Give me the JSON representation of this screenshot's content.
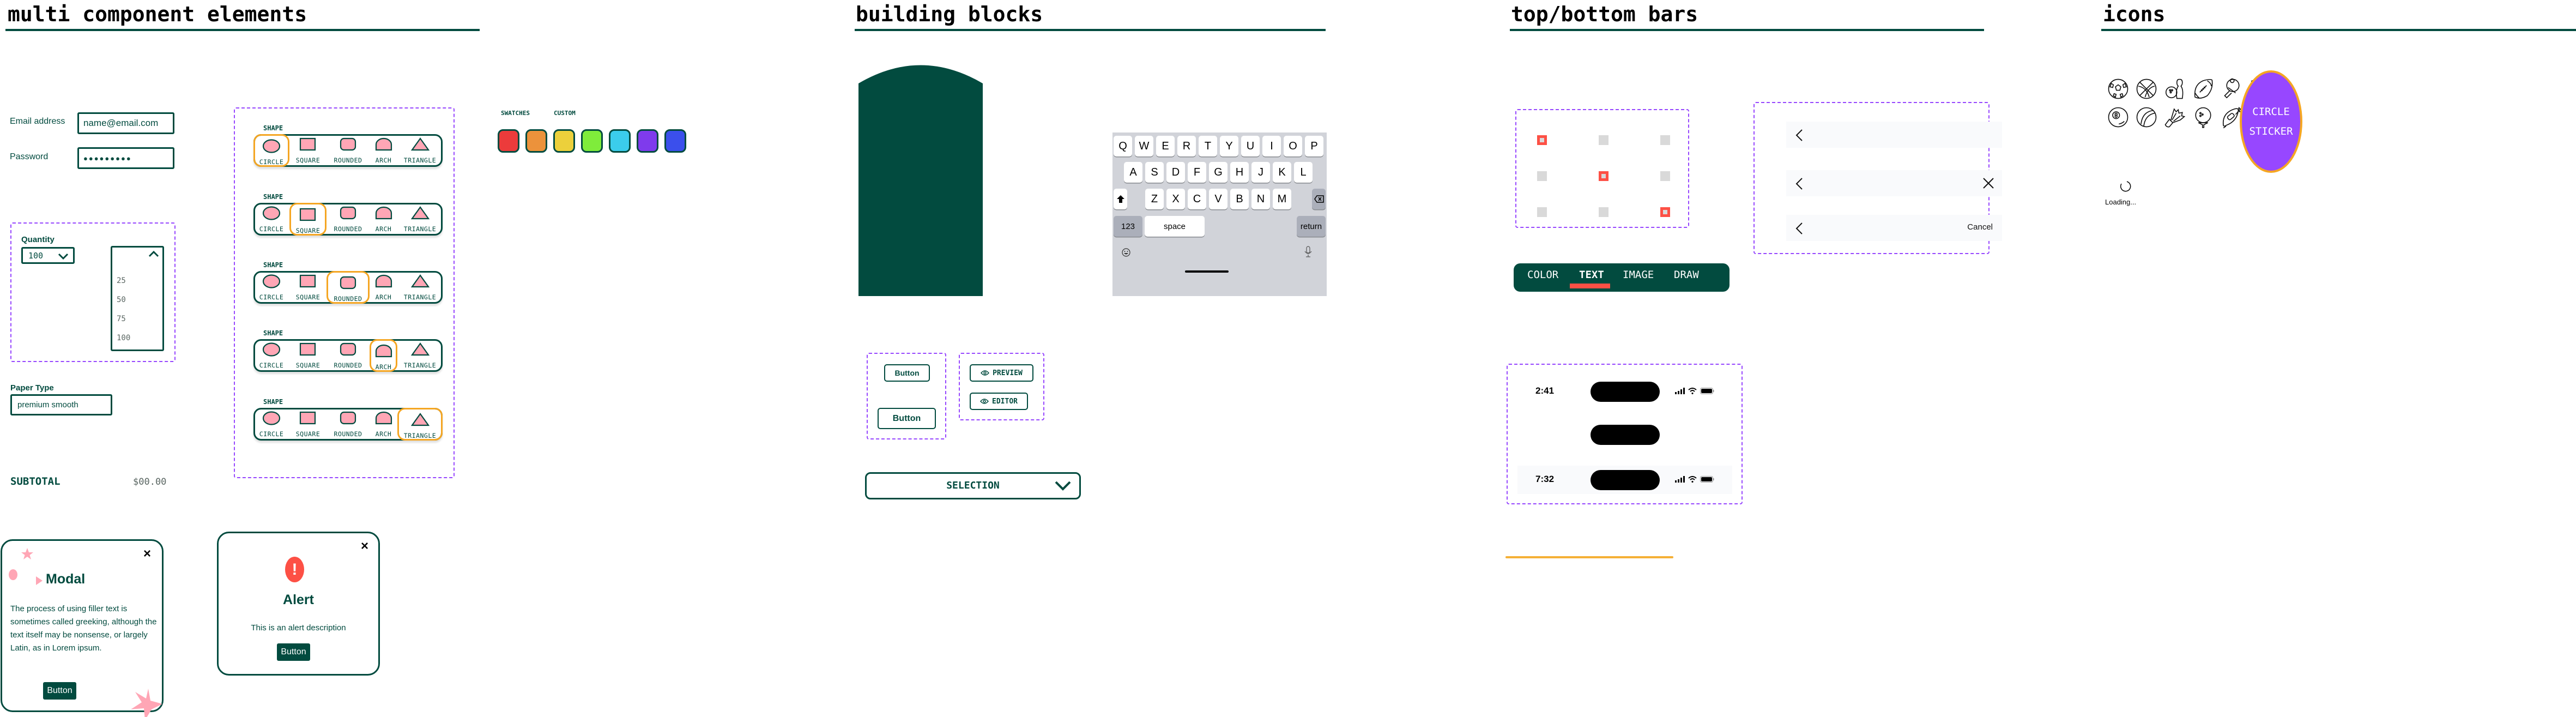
{
  "sections": {
    "multi": "multi component elements",
    "building": "building blocks",
    "bars": "top/bottom bars",
    "icons": "icons"
  },
  "login": {
    "email_label": "Email address",
    "email_value": "name@email.com",
    "password_label": "Password",
    "password_value": "●●●●●●●●●"
  },
  "quantity": {
    "label": "Quantity",
    "selected": "100",
    "options": [
      "25",
      "50",
      "75",
      "100"
    ]
  },
  "paper": {
    "label": "Paper Type",
    "value": "premium smooth"
  },
  "subtotal": {
    "label": "SUBTOTAL",
    "value": "$00.00"
  },
  "shape_selectors": {
    "label": "SHAPE",
    "options": [
      "CIRCLE",
      "SQUARE",
      "ROUNDED",
      "ARCH",
      "TRIANGLE"
    ],
    "selected_per_row": [
      "CIRCLE",
      "SQUARE",
      "ROUNDED",
      "ARCH",
      "TRIANGLE"
    ]
  },
  "swatches": {
    "tabs": [
      "SWATCHES",
      "CUSTOM"
    ],
    "colors": [
      "#ec3b3b",
      "#ec923b",
      "#ecd03b",
      "#7fec3b",
      "#3bcdec",
      "#7f3bec",
      "#3b4fec"
    ]
  },
  "modal": {
    "title": "Modal",
    "body": "The process of using filler text is sometimes called greeking, although the text itself may be nonsense, or largely Latin, as in Lorem ipsum.",
    "button": "Button",
    "close": "×"
  },
  "alert": {
    "title": "Alert",
    "description": "This is an alert description",
    "button": "Button",
    "close": "×",
    "icon": "!"
  },
  "keyboard": {
    "row1": [
      "Q",
      "W",
      "E",
      "R",
      "T",
      "Y",
      "U",
      "I",
      "O",
      "P"
    ],
    "row2": [
      "A",
      "S",
      "D",
      "F",
      "G",
      "H",
      "J",
      "K",
      "L"
    ],
    "row3": [
      "Z",
      "X",
      "C",
      "V",
      "B",
      "N",
      "M"
    ],
    "numbers": "123",
    "space": "space",
    "return": "return"
  },
  "buttons": {
    "small": "Button",
    "large": "Button",
    "preview": "PREVIEW",
    "editor": "EDITOR",
    "selection": "SELECTION"
  },
  "bars": {
    "tabs": [
      "COLOR",
      "TEXT",
      "IMAGE",
      "DRAW"
    ],
    "active_tab": "TEXT",
    "nav_cancel": "Cancel",
    "status_times": [
      "2:41",
      "7:32"
    ],
    "grid_selected": [
      [
        0,
        0
      ],
      [
        1,
        1
      ],
      [
        2,
        2
      ]
    ]
  },
  "icons": {
    "sports": [
      "soccer-ball",
      "basketball",
      "bowling",
      "football",
      "ping-pong",
      "archery",
      "billiard-ball",
      "tennis-ball",
      "shuttlecock",
      "golf-ball",
      "kayak",
      "bicycle"
    ],
    "loading": "Loading...",
    "sticker_line1": "CIRCLE",
    "sticker_line2": "STICKER"
  }
}
